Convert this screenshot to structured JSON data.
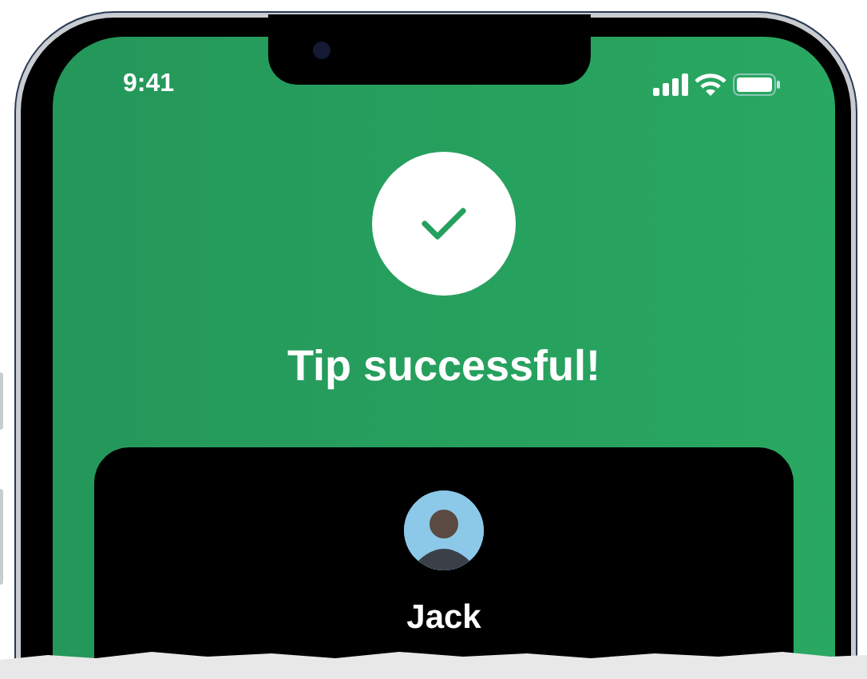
{
  "status_bar": {
    "time": "9:41"
  },
  "title": "Tip successful!",
  "recipient": {
    "name": "Jack"
  }
}
